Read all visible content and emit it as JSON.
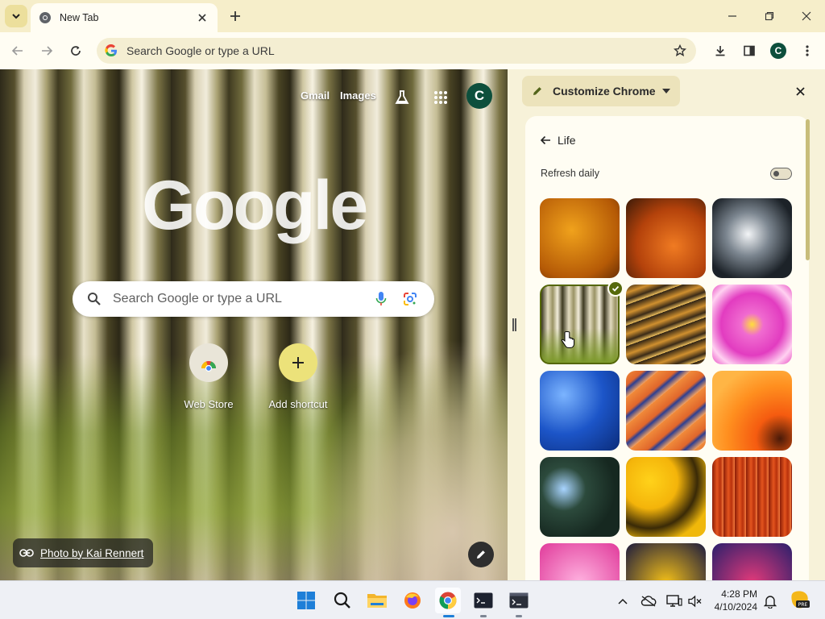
{
  "browser": {
    "tab_title": "New Tab",
    "omnibox_text": "Search Google or type a URL",
    "profile_initial": "C"
  },
  "ntp": {
    "links": {
      "gmail": "Gmail",
      "images": "Images"
    },
    "avatar_initial": "C",
    "logo_text": "Google",
    "search_placeholder": "Search Google or type a URL",
    "shortcuts": [
      {
        "label": "Web Store"
      },
      {
        "label": "Add shortcut"
      }
    ],
    "attribution": "Photo by Kai Rennert"
  },
  "side_panel": {
    "title": "Customize Chrome",
    "collection": "Life",
    "refresh_daily_label": "Refresh daily",
    "refresh_daily_on": false,
    "selected_tile_index": 3
  },
  "taskbar": {
    "time": "4:28 PM",
    "date": "4/10/2024"
  },
  "colors": {
    "accent_green": "#56690b",
    "avatar_green": "#0d4f3c",
    "chrome_bg": "#f7f2d9"
  }
}
